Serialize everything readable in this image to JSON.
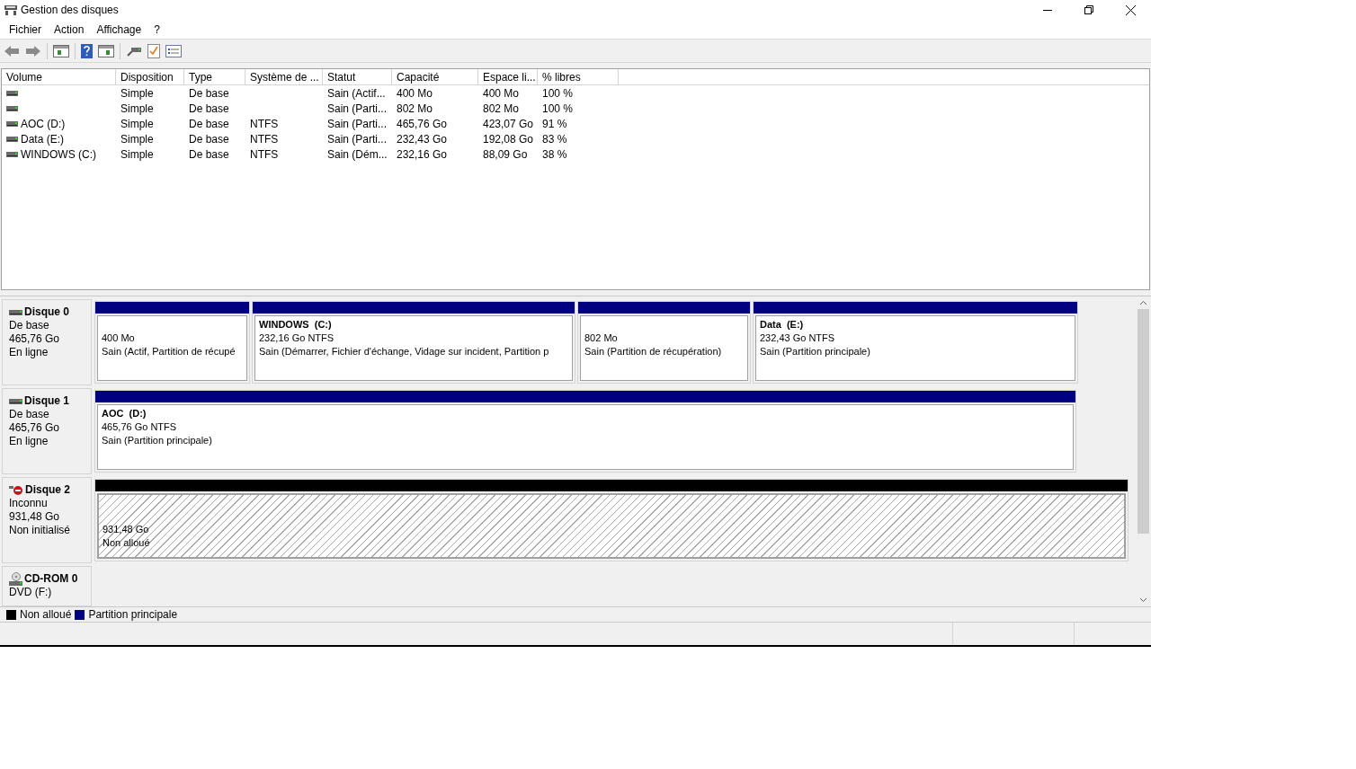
{
  "window": {
    "title": "Gestion des disques"
  },
  "menu": [
    "Fichier",
    "Action",
    "Affichage",
    "?"
  ],
  "table": {
    "columns": [
      "Volume",
      "Disposition",
      "Type",
      "Système de ...",
      "Statut",
      "Capacité",
      "Espace li...",
      "% libres"
    ],
    "rows": [
      {
        "cells": [
          "",
          "Simple",
          "De base",
          "",
          "Sain (Actif...",
          "400 Mo",
          "400 Mo",
          "100 %"
        ]
      },
      {
        "cells": [
          "",
          "Simple",
          "De base",
          "",
          "Sain (Parti...",
          "802 Mo",
          "802 Mo",
          "100 %"
        ]
      },
      {
        "cells": [
          "AOC (D:)",
          "Simple",
          "De base",
          "NTFS",
          "Sain (Parti...",
          "465,76 Go",
          "423,07 Go",
          "91 %"
        ]
      },
      {
        "cells": [
          "Data (E:)",
          "Simple",
          "De base",
          "NTFS",
          "Sain (Parti...",
          "232,43 Go",
          "192,08 Go",
          "83 %"
        ]
      },
      {
        "cells": [
          "WINDOWS (C:)",
          "Simple",
          "De base",
          "NTFS",
          "Sain (Dém...",
          "232,16 Go",
          "88,09 Go",
          "38 %"
        ]
      }
    ]
  },
  "disks": [
    {
      "kind": "disk",
      "name": "Disque 0",
      "info": [
        "De base",
        "465,76 Go",
        "En ligne"
      ],
      "partitions": [
        {
          "kind": "primary",
          "lines": [
            "400 Mo",
            "Sain (Actif, Partition de récupé"
          ]
        },
        {
          "kind": "primary",
          "name": "WINDOWS  (C:)",
          "lines": [
            "232,16 Go NTFS",
            "Sain (Démarrer, Fichier d'échange, Vidage sur incident, Partition p"
          ]
        },
        {
          "kind": "primary",
          "lines": [
            "802 Mo",
            "Sain (Partition de récupération)"
          ]
        },
        {
          "kind": "primary",
          "name": "Data  (E:)",
          "lines": [
            "232,43 Go NTFS",
            "Sain (Partition principale)"
          ]
        }
      ]
    },
    {
      "kind": "disk",
      "name": "Disque 1",
      "info": [
        "De base",
        "465,76 Go",
        "En ligne"
      ],
      "partitions": [
        {
          "kind": "primary",
          "name": "AOC  (D:)",
          "lines": [
            "465,76 Go NTFS",
            "Sain (Partition principale)"
          ]
        }
      ]
    },
    {
      "kind": "unknown",
      "name": "Disque 2",
      "info": [
        "Inconnu",
        "931,48 Go",
        "Non initialisé"
      ],
      "partitions": [
        {
          "kind": "unallocated",
          "lines": [
            "931,48 Go",
            "Non alloué"
          ]
        }
      ]
    },
    {
      "kind": "cdrom",
      "name": "CD-ROM 0",
      "info": [
        "DVD (F:)"
      ]
    }
  ],
  "legend": [
    {
      "label": "Non alloué",
      "color": "#000000"
    },
    {
      "label": "Partition principale",
      "color": "#000080"
    }
  ]
}
